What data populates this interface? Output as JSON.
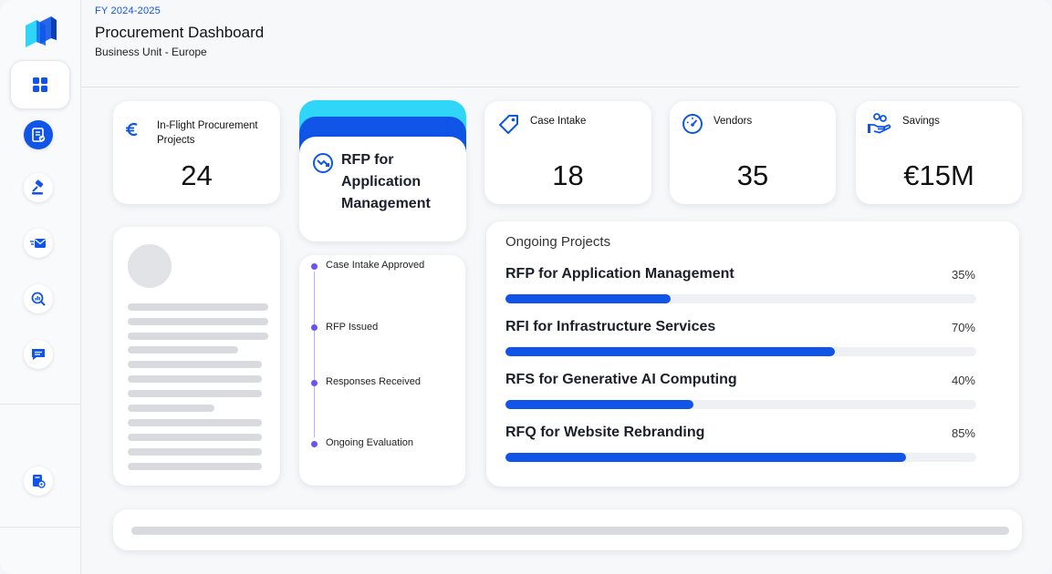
{
  "header": {
    "fiscal_year": "FY 2024-2025",
    "title": "Procurement Dashboard",
    "subtitle": "Business Unit - Europe"
  },
  "sidebar": {
    "items": [
      {
        "icon": "dashboard-grid-icon",
        "active": true
      },
      {
        "icon": "document-check-icon",
        "active": false
      },
      {
        "icon": "gavel-icon",
        "active": false
      },
      {
        "icon": "mail-icon",
        "active": false
      },
      {
        "icon": "search-analytics-icon",
        "active": false
      },
      {
        "icon": "chat-icon",
        "active": false
      },
      {
        "icon": "settings-document-icon",
        "active": false
      }
    ]
  },
  "stats": [
    {
      "label": "In-Flight Procurement Projects",
      "value": "24",
      "icon": "euro-icon"
    },
    {
      "label": "Case Intake",
      "value": "18",
      "icon": "tag-icon"
    },
    {
      "label": "Vendors",
      "value": "35",
      "icon": "gauge-icon"
    },
    {
      "label": "Savings",
      "value": "€15M",
      "icon": "hand-coins-icon"
    }
  ],
  "rfp_card": {
    "title": "RFP for Application Management",
    "icon": "trend-down-circle-icon"
  },
  "timeline": [
    {
      "label": "Case Intake Approved"
    },
    {
      "label": "RFP Issued"
    },
    {
      "label": "Responses Received"
    },
    {
      "label": "Ongoing Evaluation"
    }
  ],
  "ongoing_projects": {
    "heading": "Ongoing Projects",
    "items": [
      {
        "name": "RFP for Application Management",
        "percent_label": "35%",
        "progress": 0.35
      },
      {
        "name": "RFI for Infrastructure Services",
        "percent_label": "70%",
        "progress": 0.7
      },
      {
        "name": "RFS for Generative AI Computing",
        "percent_label": "40%",
        "progress": 0.4
      },
      {
        "name": "RFQ for Website Rebranding",
        "percent_label": "85%",
        "progress": 0.85
      }
    ]
  },
  "colors": {
    "accent": "#1055e8",
    "accent_cyan": "#2fd6f8",
    "timeline": "#6c54e6"
  }
}
